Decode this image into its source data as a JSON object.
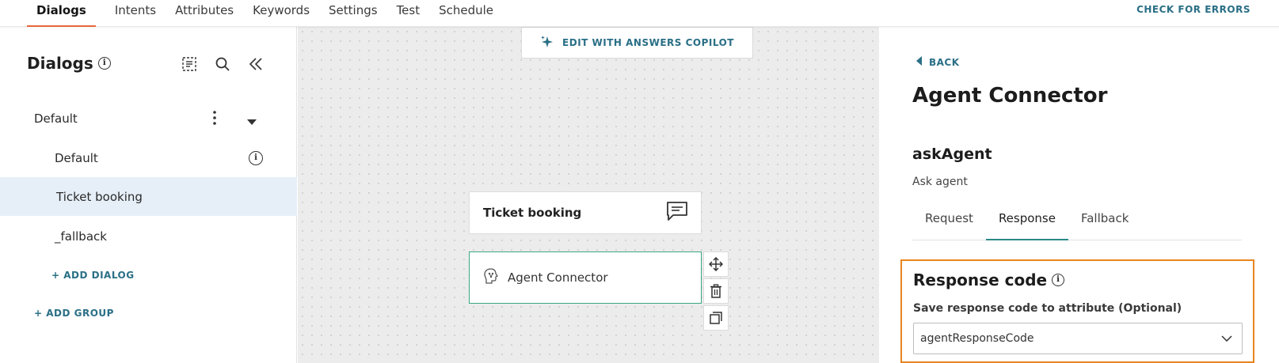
{
  "nav": {
    "tabs": [
      "Dialogs",
      "Intents",
      "Attributes",
      "Keywords",
      "Settings",
      "Test",
      "Schedule"
    ],
    "active_tab": "Dialogs",
    "check_errors": "CHECK FOR ERRORS"
  },
  "sidebar": {
    "title": "Dialogs",
    "icons": [
      "outline-icon",
      "search-icon",
      "collapse-icon"
    ],
    "group": {
      "label": "Default"
    },
    "items": [
      {
        "label": "Default"
      },
      {
        "label": "Ticket booking",
        "selected": true
      },
      {
        "label": "_fallback"
      }
    ],
    "add_dialog": "+ ADD DIALOG",
    "add_group": "+ ADD GROUP"
  },
  "canvas": {
    "copilot_button": "EDIT WITH ANSWERS COPILOT",
    "nodes": {
      "ticket_booking": "Ticket booking",
      "agent_connector": "Agent Connector"
    },
    "tools": [
      "move-icon",
      "trash-icon",
      "duplicate-icon"
    ]
  },
  "panel": {
    "back": "BACK",
    "title": "Agent Connector",
    "name": "askAgent",
    "description": "Ask agent",
    "tabs": [
      "Request",
      "Response",
      "Fallback"
    ],
    "active_tab": "Response",
    "response_code": {
      "title": "Response code",
      "label": "Save response code to attribute (Optional)",
      "value": "agentResponseCode"
    }
  },
  "colors": {
    "accent_link": "#2a6f86",
    "active_tab_underline": "#e8673a",
    "node_border": "#3aa680",
    "highlight_box": "#e8851e",
    "selected_row": "#e6eff8"
  }
}
